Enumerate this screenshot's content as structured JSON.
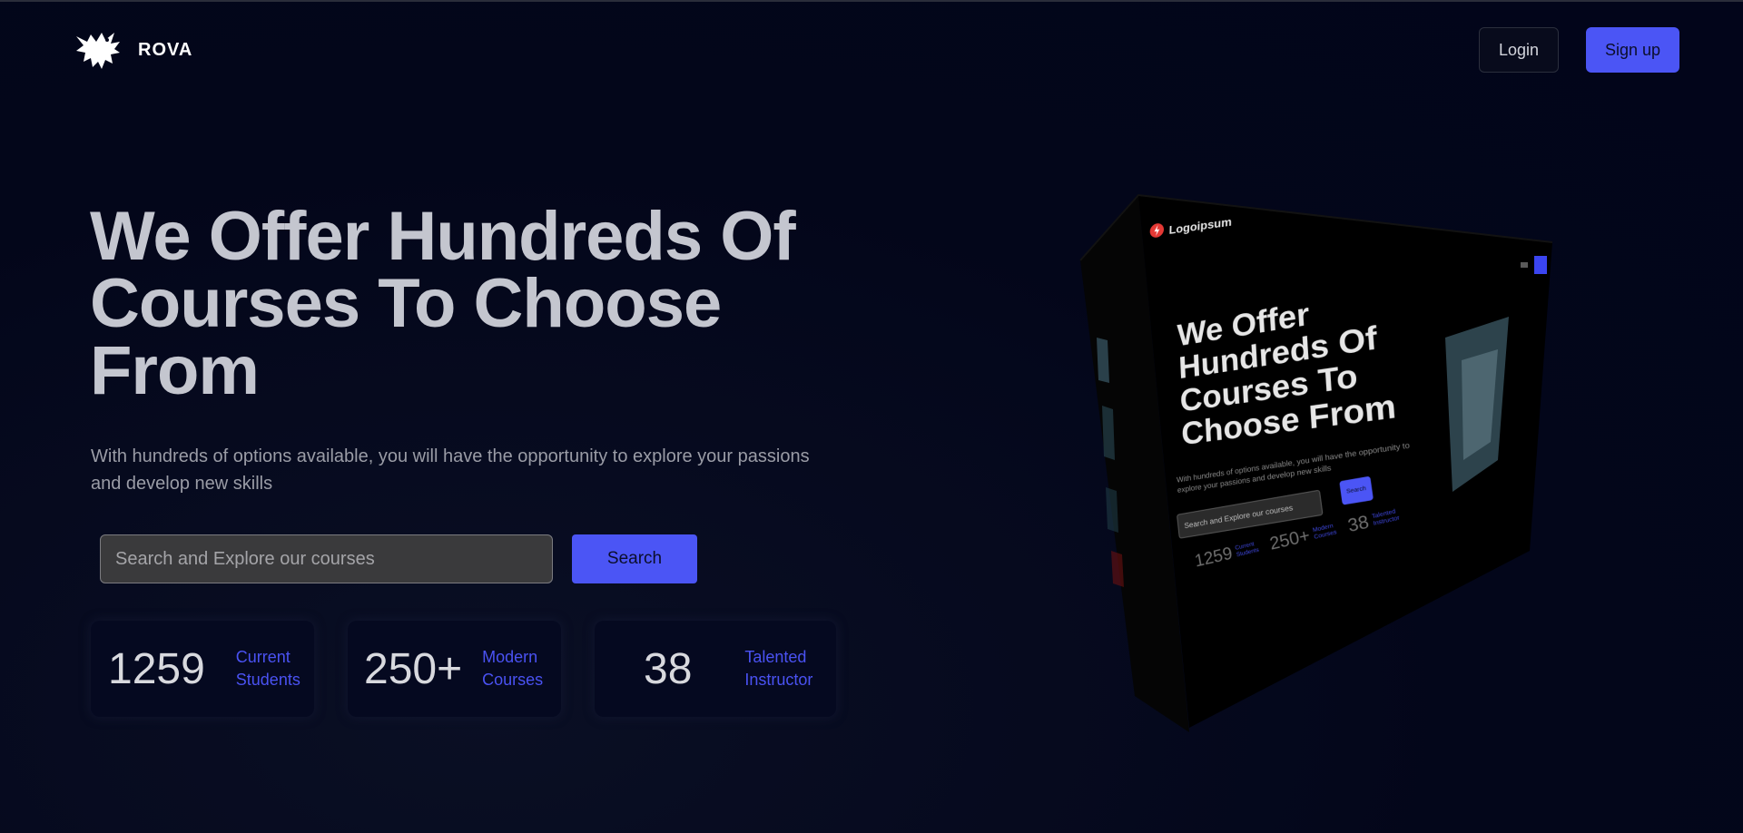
{
  "brand": {
    "name": "ROVA",
    "logo_icon": "bird-logo-icon"
  },
  "header": {
    "login_label": "Login",
    "signup_label": "Sign up"
  },
  "hero": {
    "title": "We Offer Hundreds Of Courses To Choose From",
    "subtitle": "With hundreds of options available, you will have the opportunity to explore your passions and develop new skills",
    "search_placeholder": "Search and Explore our courses",
    "search_value": "",
    "search_button": "Search"
  },
  "stats": [
    {
      "value": "1259",
      "label_line1": "Current",
      "label_line2": "Students"
    },
    {
      "value": "250+",
      "label_line1": "Modern",
      "label_line2": "Courses"
    },
    {
      "value": "38",
      "label_line1": "Talented",
      "label_line2": "Instructor"
    }
  ],
  "mockup": {
    "logo_text": "Logoipsum",
    "title": "We Offer Hundreds Of Courses To Choose From",
    "subtitle": "With hundreds of options available, you will have the opportunity to explore your passions and develop new skills",
    "search_placeholder": "Search and Explore our courses",
    "search_button": "Search",
    "stats": [
      {
        "value": "1259",
        "label_line1": "Current",
        "label_line2": "Students"
      },
      {
        "value": "250+",
        "label_line1": "Modern",
        "label_line2": "Courses"
      },
      {
        "value": "38",
        "label_line1": "Talented",
        "label_line2": "Instructor"
      }
    ]
  },
  "colors": {
    "background": "#03061a",
    "accent": "#4b55f5",
    "title_text": "#c4c6cf",
    "stat_label": "#4a52f2"
  }
}
